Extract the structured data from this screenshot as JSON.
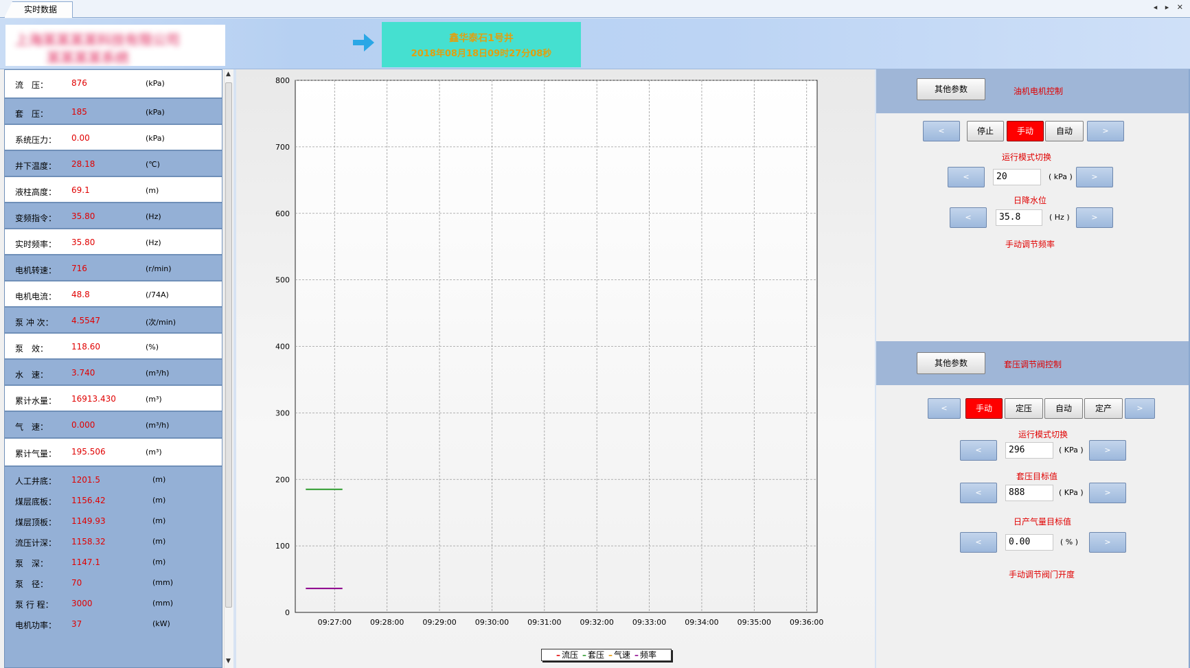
{
  "tab": {
    "label": "实时数据",
    "controls": "◂ ▸ ✕"
  },
  "header": {
    "logo_text_line1": "上海某某某某科技有限公司",
    "logo_text_line2": "某某某某系统",
    "banner_line1": "鑫华泰石1号井",
    "banner_line2": "2018年08月18日09时27分08秒",
    "arrow_color": "#2aa7e6"
  },
  "left_rows": [
    {
      "label": "流　压：",
      "value": "876",
      "unit": "(kPa)"
    },
    {
      "label": "套　压：",
      "value": "185",
      "unit": "(kPa)"
    },
    {
      "label": "系统压力：",
      "value": "0.00",
      "unit": "(kPa)"
    },
    {
      "label": "井下温度：",
      "value": "28.18",
      "unit": "(℃)"
    },
    {
      "label": "液柱高度：",
      "value": "69.1",
      "unit": "(m)"
    },
    {
      "label": "变频指令：",
      "value": "35.80",
      "unit": "(Hz)"
    },
    {
      "label": "实时频率：",
      "value": "35.80",
      "unit": "(Hz)"
    },
    {
      "label": "电机转速：",
      "value": "716",
      "unit": "(r/min)"
    },
    {
      "label": "电机电流：",
      "value": "48.8",
      "unit": "(/74A)"
    },
    {
      "label": "泵 冲 次：",
      "value": "4.5547",
      "unit": "(次/min)"
    },
    {
      "label": "泵　效：",
      "value": "118.60",
      "unit": "(%)"
    },
    {
      "label": "水　速：",
      "value": "3.740",
      "unit": "(m³/h)"
    },
    {
      "label": "累计水量：",
      "value": "16913.430",
      "unit": "(m³)"
    },
    {
      "label": "气　速：",
      "value": "0.000",
      "unit": "(m³/h)"
    },
    {
      "label": "累计气量：",
      "value": "195.506",
      "unit": "(m³)"
    }
  ],
  "left_bottom": [
    {
      "label": "人工井底：",
      "value": "1201.5",
      "unit": "(m)"
    },
    {
      "label": "煤层底板：",
      "value": "1156.42",
      "unit": "(m)"
    },
    {
      "label": "煤层顶板：",
      "value": "1149.93",
      "unit": "(m)"
    },
    {
      "label": "流压计深：",
      "value": "1158.32",
      "unit": "(m)"
    },
    {
      "label": "泵　深：",
      "value": "1147.1",
      "unit": "(m)"
    },
    {
      "label": "泵　径：",
      "value": "70",
      "unit": "(mm)"
    },
    {
      "label": "泵 行 程：",
      "value": "3000",
      "unit": "(mm)"
    },
    {
      "label": "电机功率：",
      "value": "37",
      "unit": "(kW)"
    }
  ],
  "chart_data": {
    "type": "line",
    "x": [
      "09:27:00",
      "09:28:00",
      "09:29:00",
      "09:30:00",
      "09:31:00",
      "09:32:00",
      "09:33:00",
      "09:34:00",
      "09:35:00",
      "09:36:00"
    ],
    "yticks": [
      0,
      100,
      200,
      300,
      400,
      500,
      600,
      700,
      800
    ],
    "ylim": [
      0,
      800
    ],
    "xlim_minutes": [
      -0.75,
      9.2
    ],
    "grid": true,
    "legend_placement": "bottom",
    "series": [
      {
        "name": "流压",
        "color": "#e00000",
        "points": []
      },
      {
        "name": "套压",
        "color": "#2a9a2a",
        "points": [
          [
            -0.55,
            185
          ],
          [
            0.15,
            185
          ]
        ]
      },
      {
        "name": "气速",
        "color": "#e69500",
        "points": []
      },
      {
        "name": "频率",
        "color": "#8b008b",
        "points": [
          [
            -0.55,
            36
          ],
          [
            0.15,
            36
          ]
        ]
      }
    ]
  },
  "right_top": {
    "other_params": "其他参数",
    "title": "油机电机控制",
    "mode_buttons": [
      "<",
      "停止",
      "手动",
      "自动",
      ">"
    ],
    "active_mode": "手动",
    "mode_caption": "运行模式切换",
    "rows": [
      {
        "value": "20",
        "unit": "( kPa )",
        "caption": "日降水位"
      },
      {
        "value": "35.8",
        "unit": "( Hz )",
        "caption": "手动调节频率"
      }
    ]
  },
  "right_bottom": {
    "other_params": "其他参数",
    "title": "套压调节阀控制",
    "mode_buttons": [
      "<",
      "手动",
      "定压",
      "自动",
      "定产",
      ">"
    ],
    "active_mode": "手动",
    "mode_caption": "运行模式切换",
    "rows": [
      {
        "value": "296",
        "unit": "( KPa )",
        "caption": "套压目标值"
      },
      {
        "value": "888",
        "unit": "( KPa )",
        "caption": "日产气量目标值"
      },
      {
        "value": "0.00",
        "unit": "( % )",
        "caption": "手动调节阀门开度"
      }
    ]
  },
  "nav_prev": "<",
  "nav_next": ">"
}
